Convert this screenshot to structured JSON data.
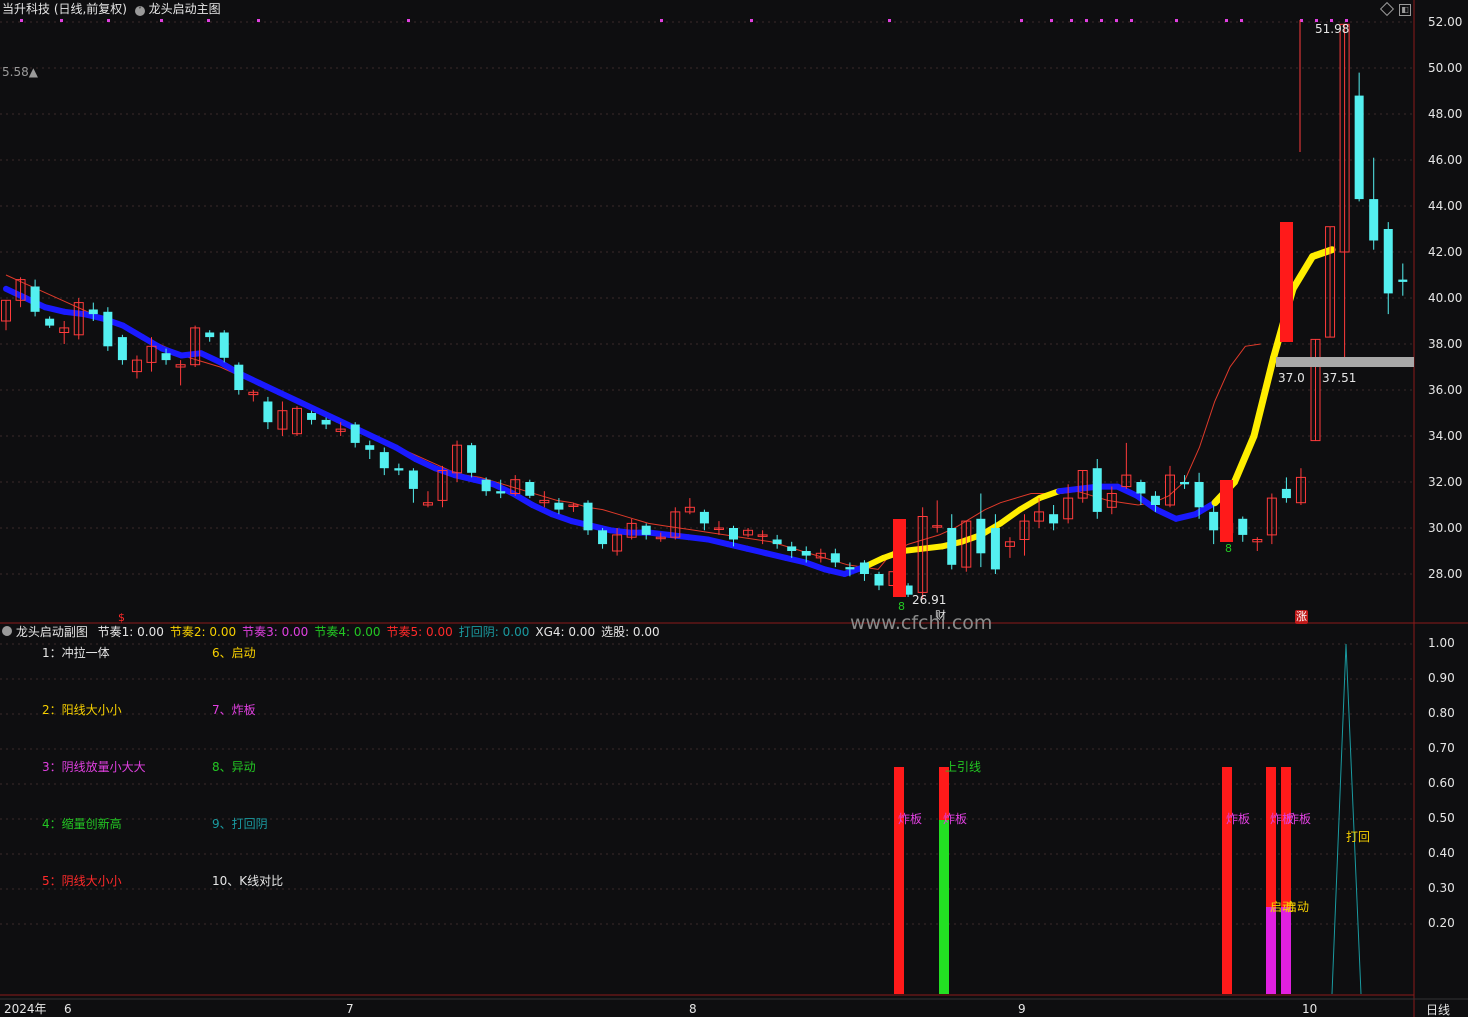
{
  "main_header": {
    "title": "当升科技 (日线,前复权)",
    "indicator": "龙头启动主图"
  },
  "sub_header": {
    "name": "龙头启动副图",
    "items": [
      {
        "label": "节奏1:",
        "value": "0.00",
        "color": "#e6e6e6"
      },
      {
        "label": "节奏2:",
        "value": "0.00",
        "color": "#f7d000"
      },
      {
        "label": "节奏3:",
        "value": "0.00",
        "color": "#e040e0"
      },
      {
        "label": "节奏4:",
        "value": "0.00",
        "color": "#23c723"
      },
      {
        "label": "节奏5:",
        "value": "0.00",
        "color": "#ff2a2a"
      },
      {
        "label": "打回阴:",
        "value": "0.00",
        "color": "#1a9aa0"
      },
      {
        "label": "XG4:",
        "value": "0.00",
        "color": "#e6e6e6"
      },
      {
        "label": "选股:",
        "value": "0.00",
        "color": "#e6e6e6"
      }
    ]
  },
  "legend": [
    {
      "text": "1：冲拉一体",
      "color": "#e6e6e6"
    },
    {
      "text": "2：阳线大小小",
      "color": "#f7d000"
    },
    {
      "text": "3：阴线放量小大大",
      "color": "#e040e0"
    },
    {
      "text": "4：缩量创新高",
      "color": "#23c723"
    },
    {
      "text": "5：阴线大小小",
      "color": "#ff2a2a"
    },
    {
      "text": "6、启动",
      "color": "#f7d000"
    },
    {
      "text": "7、炸板",
      "color": "#e040e0"
    },
    {
      "text": "8、异动",
      "color": "#23c723"
    },
    {
      "text": "9、打回阴",
      "color": "#1a9aa0"
    },
    {
      "text": "10、K线对比",
      "color": "#e6e6e6"
    }
  ],
  "price_axis": [
    "52.00",
    "50.00",
    "48.00",
    "46.00",
    "44.00",
    "42.00",
    "40.00",
    "38.00",
    "36.00",
    "34.00",
    "32.00",
    "30.00",
    "28.00"
  ],
  "ind_axis": [
    "1.00",
    "0.90",
    "0.80",
    "0.70",
    "0.60",
    "0.50",
    "0.40",
    "0.30",
    "0.20"
  ],
  "x_axis": [
    "2024年",
    "6",
    "7",
    "8",
    "9",
    "10"
  ],
  "period_label": "日线",
  "left_value": "5.58▲",
  "annotations": {
    "high": "51.98",
    "low": "26.91",
    "range_left": "37.0",
    "range_right": "37.51",
    "num_8a": "8",
    "num_8b": "8",
    "cai": "财",
    "dollar": "$",
    "zhang": "涨",
    "shangyin": "上引线",
    "zhaban": "炸板",
    "daohui": "打回",
    "qidong": "启动"
  },
  "watermark": "www.cfchi.com",
  "colors": {
    "up": "#ff3b3b",
    "down": "#54f0f0",
    "signal_red": "#ff1a1a",
    "ma_blue": "#1a1aff",
    "ma_yellow": "#ffee00",
    "ma_red": "#e03a2a"
  },
  "chart_data": {
    "type": "candlestick",
    "series": [
      {
        "name": "K",
        "ohlc": [
          [
            39.0,
            39.9,
            38.6,
            38.4
          ],
          [
            39.9,
            40.8,
            39.6,
            40.9
          ],
          [
            40.5,
            39.4,
            39.2,
            40.8
          ],
          [
            39.1,
            38.8,
            38.7,
            39.2
          ],
          [
            38.5,
            38.7,
            38.0,
            39.0
          ],
          [
            38.4,
            39.8,
            38.2,
            40.0
          ],
          [
            39.5,
            39.3,
            39.0,
            39.8
          ],
          [
            39.4,
            37.9,
            37.7,
            39.6
          ],
          [
            38.3,
            37.3,
            37.1,
            38.4
          ],
          [
            36.8,
            37.3,
            36.5,
            37.5
          ],
          [
            37.2,
            37.9,
            36.8,
            38.3
          ],
          [
            37.6,
            37.3,
            37.1,
            37.8
          ],
          [
            37.0,
            37.1,
            36.2,
            37.3
          ],
          [
            37.1,
            38.7,
            37.0,
            38.8
          ],
          [
            38.5,
            38.3,
            38.1,
            38.6
          ],
          [
            38.5,
            37.4,
            37.2,
            38.6
          ],
          [
            37.1,
            36.0,
            35.8,
            37.2
          ],
          [
            35.8,
            35.9,
            35.5,
            36.0
          ],
          [
            35.5,
            34.6,
            34.3,
            35.7
          ],
          [
            34.3,
            35.1,
            34.0,
            35.5
          ],
          [
            34.1,
            35.2,
            34.0,
            35.3
          ],
          [
            35.0,
            34.7,
            34.5,
            35.1
          ],
          [
            34.7,
            34.5,
            34.3,
            34.8
          ],
          [
            34.2,
            34.3,
            34.0,
            34.6
          ],
          [
            34.5,
            33.7,
            33.5,
            34.6
          ],
          [
            33.6,
            33.4,
            33.0,
            33.8
          ],
          [
            33.3,
            32.6,
            32.3,
            33.5
          ],
          [
            32.6,
            32.5,
            32.3,
            32.8
          ],
          [
            32.5,
            31.7,
            31.1,
            32.6
          ],
          [
            31.0,
            31.1,
            30.9,
            31.6
          ],
          [
            31.2,
            32.5,
            30.9,
            32.7
          ],
          [
            32.4,
            33.6,
            32.0,
            33.8
          ],
          [
            33.6,
            32.4,
            32.2,
            33.7
          ],
          [
            32.1,
            31.6,
            31.4,
            32.2
          ],
          [
            31.6,
            31.5,
            31.3,
            32.1
          ],
          [
            31.5,
            32.1,
            31.4,
            32.3
          ],
          [
            32.0,
            31.4,
            31.3,
            32.1
          ],
          [
            31.1,
            31.2,
            30.9,
            31.6
          ],
          [
            31.1,
            30.8,
            30.6,
            31.3
          ],
          [
            31.0,
            31.0,
            30.7,
            31.1
          ],
          [
            31.1,
            29.9,
            29.7,
            31.2
          ],
          [
            29.9,
            29.3,
            29.1,
            30.0
          ],
          [
            29.0,
            29.7,
            28.8,
            30.0
          ],
          [
            29.6,
            30.2,
            29.5,
            30.4
          ],
          [
            30.1,
            29.7,
            29.5,
            30.2
          ],
          [
            29.6,
            29.6,
            29.4,
            29.8
          ],
          [
            29.6,
            30.7,
            29.5,
            30.9
          ],
          [
            30.7,
            30.9,
            30.6,
            31.3
          ],
          [
            30.7,
            30.2,
            29.9,
            30.8
          ],
          [
            30.0,
            30.0,
            29.7,
            30.3
          ],
          [
            30.0,
            29.5,
            29.2,
            30.1
          ],
          [
            29.7,
            29.9,
            29.6,
            30.0
          ],
          [
            29.7,
            29.7,
            29.3,
            29.9
          ],
          [
            29.5,
            29.3,
            29.1,
            29.7
          ],
          [
            29.2,
            29.0,
            28.7,
            29.4
          ],
          [
            29.0,
            28.8,
            28.5,
            29.2
          ],
          [
            28.7,
            28.9,
            28.5,
            29.1
          ],
          [
            28.9,
            28.5,
            28.3,
            29.1
          ],
          [
            28.3,
            28.2,
            27.9,
            28.5
          ],
          [
            28.5,
            28.0,
            27.7,
            28.6
          ],
          [
            28.0,
            27.5,
            27.3,
            28.1
          ],
          [
            27.5,
            28.1,
            27.2,
            28.4
          ],
          [
            27.5,
            27.1,
            27.0,
            27.6
          ],
          [
            27.2,
            30.5,
            26.9,
            30.9
          ],
          [
            30.1,
            30.1,
            29.8,
            31.2
          ],
          [
            30.0,
            28.4,
            28.2,
            30.6
          ],
          [
            28.3,
            30.3,
            28.1,
            30.3
          ],
          [
            30.4,
            28.9,
            28.3,
            31.5
          ],
          [
            30.0,
            28.2,
            28.0,
            30.6
          ],
          [
            29.2,
            29.4,
            28.7,
            29.6
          ],
          [
            29.5,
            30.3,
            28.8,
            30.6
          ],
          [
            30.3,
            30.7,
            30.0,
            31.3
          ],
          [
            30.6,
            30.2,
            29.9,
            31.0
          ],
          [
            30.4,
            31.3,
            30.2,
            31.9
          ],
          [
            31.3,
            32.5,
            31.1,
            32.3
          ],
          [
            32.6,
            30.7,
            30.4,
            33.0
          ],
          [
            30.9,
            31.5,
            30.6,
            31.8
          ],
          [
            31.8,
            32.3,
            31.7,
            33.7
          ],
          [
            32.0,
            31.5,
            31.0,
            32.1
          ],
          [
            31.4,
            31.0,
            30.7,
            31.6
          ],
          [
            31.0,
            32.3,
            30.9,
            32.7
          ],
          [
            32.0,
            31.9,
            31.7,
            32.3
          ],
          [
            32.0,
            30.9,
            30.4,
            32.4
          ],
          [
            30.7,
            29.9,
            29.3,
            31.0
          ],
          [
            29.8,
            30.2,
            29.6,
            31.0
          ],
          [
            30.4,
            29.7,
            29.4,
            30.5
          ],
          [
            29.4,
            29.5,
            29.0,
            29.6
          ],
          [
            29.7,
            31.3,
            29.3,
            31.5
          ],
          [
            31.7,
            31.3,
            31.1,
            32.2
          ],
          [
            31.1,
            32.2,
            31.0,
            32.6
          ],
          [
            33.8,
            38.2,
            33.8,
            38.2
          ],
          [
            38.3,
            43.1,
            38.3,
            43.1
          ],
          [
            42.0,
            51.9,
            37.3,
            51.9
          ],
          [
            48.8,
            44.3,
            44.2,
            49.8
          ],
          [
            44.3,
            42.5,
            42.1,
            46.1
          ],
          [
            43.0,
            40.2,
            39.3,
            43.3
          ],
          [
            40.8,
            40.7,
            40.1,
            41.5
          ]
        ]
      },
      {
        "name": "MA-red",
        "values": [
          41.0,
          40.7,
          40.4,
          40.1,
          39.8,
          39.5,
          39.2,
          38.9,
          38.6,
          38.3,
          38.0,
          37.7,
          37.4,
          37.2,
          37.0,
          36.7,
          36.4,
          36.1,
          35.8,
          35.5,
          35.2,
          34.9,
          34.6,
          34.3,
          34.0,
          33.7,
          33.4,
          33.1,
          32.8,
          32.5,
          32.3,
          32.2,
          32.0,
          31.8,
          31.6,
          31.4,
          31.2,
          31.1,
          30.9,
          30.8,
          30.6,
          30.4,
          30.2,
          30.1,
          30.0,
          29.9,
          29.8,
          29.7,
          29.6,
          29.5,
          29.4,
          29.2,
          29.0,
          28.8,
          28.6,
          28.4,
          28.3,
          28.2,
          29.0,
          29.3,
          29.5,
          29.7,
          30.0,
          30.4,
          30.8,
          31.1,
          31.3,
          31.5,
          31.5,
          31.5,
          31.6,
          31.4,
          31.2,
          31.1,
          31.0,
          31.1,
          31.4,
          32.0,
          33.5,
          35.5,
          37.0,
          37.9,
          38.0
        ]
      },
      {
        "name": "MA-band",
        "values": [
          40.4,
          40.0,
          39.6,
          39.4,
          39.3,
          39.1,
          38.8,
          38.3,
          37.8,
          37.5,
          37.6,
          37.2,
          36.7,
          36.3,
          35.9,
          35.5,
          35.1,
          34.7,
          34.3,
          33.9,
          33.5,
          33.0,
          32.6,
          32.3,
          32.1,
          31.9,
          31.5,
          31.0,
          30.6,
          30.3,
          30.1,
          29.9,
          29.8,
          29.8,
          29.7,
          29.6,
          29.5,
          29.3,
          29.1,
          28.9,
          28.7,
          28.5,
          28.2,
          28.0,
          28.3,
          28.7,
          29.0,
          29.1,
          29.2,
          29.4,
          29.7,
          30.2,
          30.8,
          31.3,
          31.6,
          31.7,
          31.8,
          31.8,
          31.4,
          30.8,
          30.4,
          30.6,
          31.1,
          32.0,
          34.0,
          37.4,
          40.4,
          41.8,
          42.1
        ]
      }
    ],
    "ylim": [
      26.0,
      52.5
    ],
    "sub_ylim": [
      0,
      1.0
    ]
  }
}
